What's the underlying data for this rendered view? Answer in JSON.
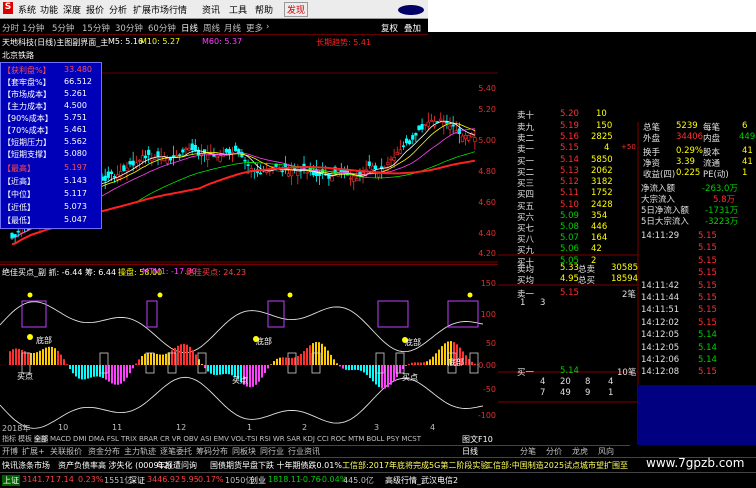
{
  "menu": {
    "logo": "S",
    "items": [
      "系统",
      "功能",
      "深度",
      "报价",
      "分析",
      "扩展市场行情",
      "资讯",
      "工具",
      "帮助"
    ],
    "active": "发现"
  },
  "periods": [
    "分时",
    "1分钟",
    "5分钟",
    "15分钟",
    "30分钟",
    "60分钟",
    "日线",
    "周线",
    "月线",
    "更多"
  ],
  "toolbar": {
    "prev": "复权",
    "next": "叠加",
    "count": "⊠"
  },
  "chart": {
    "title": "天地科技(日线)主图副界面_主",
    "ma5": "M5: 5.16",
    "ma10": "M10: 5.27",
    "ma60": "M60: 5.37",
    "trend": "长期趋势: 5.41",
    "sub": "北京铁路",
    "yticks": [
      "5.40",
      "5.20",
      "5.00",
      "4.80",
      "4.60",
      "4.40",
      "4.20"
    ],
    "bottom_label": "2018年",
    "xticks": [
      "10",
      "11",
      "12",
      "1",
      "2",
      "3",
      "4"
    ]
  },
  "info_panel": [
    {
      "k": "【获利盘%】",
      "v": "33.480"
    },
    {
      "k": "【套牢盘%】",
      "v": "66.512"
    },
    {
      "k": "【市场成本】",
      "v": "5.261"
    },
    {
      "k": "【主力成本】",
      "v": "4.500"
    },
    {
      "k": "【90%成本】",
      "v": "5.751"
    },
    {
      "k": "【70%成本】",
      "v": "5.461"
    },
    {
      "k": "【短期压力】",
      "v": "5.562"
    },
    {
      "k": "【短期支撑】",
      "v": "5.080"
    },
    {
      "k": "【最高】",
      "v": "5.197"
    },
    {
      "k": "【近高】",
      "v": "5.143"
    },
    {
      "k": "【中位】",
      "v": "5.117"
    },
    {
      "k": "【近低】",
      "v": "5.073"
    },
    {
      "k": "【最低】",
      "v": "5.047"
    }
  ],
  "osc": {
    "title": "绝佳买点_副 抓: -6.44 筹: 6.44",
    "v1": "操盘: 58.00",
    "v2": "MTM1: -17.30",
    "v3": "绝佳买点: 24.23",
    "yticks": [
      "150",
      "100",
      "50",
      "0.00",
      "-50",
      "-100"
    ],
    "labels": [
      "底部",
      "底部",
      "底部",
      "底部",
      "买点",
      "买点",
      "买点"
    ]
  },
  "indicator_tabs": [
    "指标",
    "模板",
    "全部",
    "MACD",
    "DMI",
    "DMA",
    "FSL",
    "TRIX",
    "BRAR",
    "CR",
    "VR",
    "OBV",
    "ASI",
    "EMV",
    "VOL-TSI",
    "RSI",
    "WR",
    "SAR",
    "KDJ",
    "CCI",
    "ROC",
    "MTM",
    "BOLL",
    "PSY",
    "MCST"
  ],
  "bottom_tabs": [
    "开博",
    "扩展+",
    "关联报价",
    "资金分布",
    "主力轨迹",
    "逐笔委托",
    "筹码分布",
    "同板块",
    "同行业",
    "行业资讯"
  ],
  "side_tabs": [
    "图文F10",
    "日线"
  ],
  "right_tabs": [
    "分笔",
    "分价",
    "龙虎",
    "风向"
  ],
  "orderbook": {
    "sell": [
      {
        "l": "卖十",
        "p": "5.20",
        "v": "10"
      },
      {
        "l": "卖九",
        "p": "5.19",
        "v": "150"
      },
      {
        "l": "卖二",
        "p": "5.16",
        "v": "2825"
      },
      {
        "l": "卖一",
        "p": "5.15",
        "v": "4"
      }
    ],
    "buy": [
      {
        "l": "买一",
        "p": "5.14",
        "v": "5850"
      },
      {
        "l": "买二",
        "p": "5.13",
        "v": "2062"
      },
      {
        "l": "买三",
        "p": "5.12",
        "v": "3182"
      },
      {
        "l": "买四",
        "p": "5.11",
        "v": "1752"
      },
      {
        "l": "买五",
        "p": "5.10",
        "v": "2428"
      },
      {
        "l": "买六",
        "p": "5.09",
        "v": "354"
      },
      {
        "l": "买七",
        "p": "5.08",
        "v": "446"
      },
      {
        "l": "买八",
        "p": "5.07",
        "v": "164"
      },
      {
        "l": "买九",
        "p": "5.06",
        "v": "42"
      },
      {
        "l": "买十",
        "p": "5.05",
        "v": "2"
      }
    ],
    "avg_buy": {
      "l": "卖均",
      "p": "5.33",
      "k": "总卖",
      "v": "30585"
    },
    "avg_sell": {
      "l": "买均",
      "p": "4.95",
      "k": "总买",
      "v": "18594"
    },
    "cur1": {
      "l": "卖一",
      "p": "5.15",
      "v": "2笔"
    },
    "row1": [
      "1",
      "3"
    ],
    "cur2": {
      "l": "买一",
      "p": "5.14",
      "v": "10笔"
    },
    "row2": [
      "4",
      "20",
      "8",
      "4"
    ],
    "row3": [
      "7",
      "49",
      "9",
      "1"
    ],
    "plus": "+50"
  },
  "stats": [
    {
      "k": "总笔",
      "v": "5239",
      "k2": "每笔",
      "v2": "6"
    },
    {
      "k": "外盘",
      "v": "34406",
      "k2": "内盘",
      "v2": "4498"
    },
    {
      "k": "换手",
      "v": "0.29%",
      "k2": "股本",
      "v2": "41"
    },
    {
      "k": "净资",
      "v": "3.39",
      "k2": "流通",
      "v2": "41"
    },
    {
      "k": "收益(四)",
      "v": "0.225",
      "k2": "PE(动)",
      "v2": "1"
    }
  ],
  "flows": [
    {
      "k": "净流入额",
      "v": "-263.0万"
    },
    {
      "k": "大宗流入",
      "v": "5.8万"
    },
    {
      "k": "5日净流入额",
      "v": "-1731万"
    },
    {
      "k": "5日大宗流入",
      "v": "-3223万"
    }
  ],
  "ticks": [
    {
      "t": "14:11:29",
      "p": "5.15",
      "v": ""
    },
    {
      "t": "",
      "p": "5.15",
      "v": ""
    },
    {
      "t": "",
      "p": "5.15",
      "v": ""
    },
    {
      "t": "",
      "p": "5.15",
      "v": ""
    },
    {
      "t": "14:11:42",
      "p": "5.15",
      "v": ""
    },
    {
      "t": "14:11:44",
      "p": "5.15",
      "v": ""
    },
    {
      "t": "14:11:51",
      "p": "5.15",
      "v": ""
    },
    {
      "t": "14:12:02",
      "p": "5.15",
      "v": ""
    },
    {
      "t": "14:12:05",
      "p": "5.14",
      "v": ""
    },
    {
      "t": "14:12:05",
      "p": "5.14",
      "v": ""
    },
    {
      "t": "14:12:06",
      "p": "5.14",
      "v": ""
    },
    {
      "t": "14:12:08",
      "p": "5.15",
      "v": ""
    }
  ],
  "news": [
    "快讯涤条市场",
    "资产负债率高 涉失化 (000912)",
    "年报遭问询",
    "国债期货早盘下跌 十年期债跌0.01%",
    "工信部:2017年底将完成5G第二阶段实验",
    "工信部:中国制造2025试点城市望扩围至"
  ],
  "status": {
    "sh_label": "上证",
    "sh": "3141.71",
    "sh_chg": "7.14",
    "sh_pct": "0.23%",
    "sh_amt": "1551亿",
    "sz_label": "深证",
    "sz": "3446.92",
    "sz_chg": "5.95",
    "sz_pct": "0.17%",
    "sz_amt": "1050亿",
    "cy_label": "创业",
    "cy": "1818.11",
    "cy_chg": "-0.76",
    "cy_pct": "-0.04%",
    "cy_amt": "445.0亿",
    "right": "高级行情_武汉电信2",
    "watermark": "www.7gpzb.com"
  }
}
